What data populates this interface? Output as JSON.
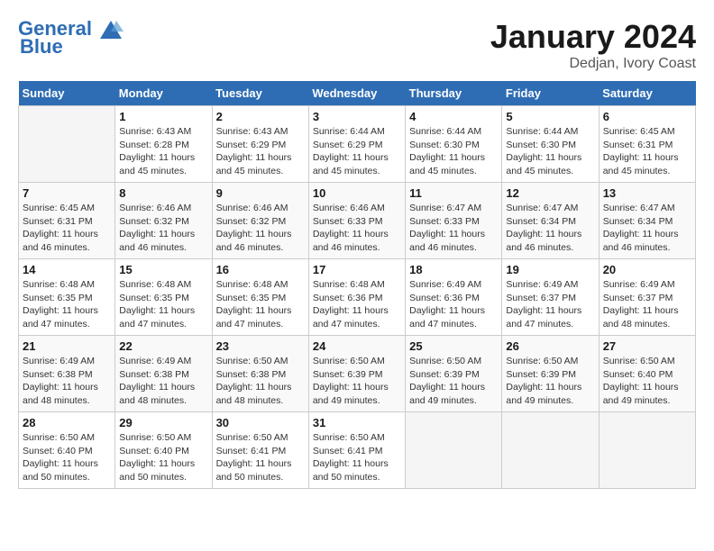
{
  "header": {
    "logo_line1": "General",
    "logo_line2": "Blue",
    "month_year": "January 2024",
    "location": "Dedjan, Ivory Coast"
  },
  "days_of_week": [
    "Sunday",
    "Monday",
    "Tuesday",
    "Wednesday",
    "Thursday",
    "Friday",
    "Saturday"
  ],
  "weeks": [
    [
      {
        "day": "",
        "info": ""
      },
      {
        "day": "1",
        "info": "Sunrise: 6:43 AM\nSunset: 6:28 PM\nDaylight: 11 hours\nand 45 minutes."
      },
      {
        "day": "2",
        "info": "Sunrise: 6:43 AM\nSunset: 6:29 PM\nDaylight: 11 hours\nand 45 minutes."
      },
      {
        "day": "3",
        "info": "Sunrise: 6:44 AM\nSunset: 6:29 PM\nDaylight: 11 hours\nand 45 minutes."
      },
      {
        "day": "4",
        "info": "Sunrise: 6:44 AM\nSunset: 6:30 PM\nDaylight: 11 hours\nand 45 minutes."
      },
      {
        "day": "5",
        "info": "Sunrise: 6:44 AM\nSunset: 6:30 PM\nDaylight: 11 hours\nand 45 minutes."
      },
      {
        "day": "6",
        "info": "Sunrise: 6:45 AM\nSunset: 6:31 PM\nDaylight: 11 hours\nand 45 minutes."
      }
    ],
    [
      {
        "day": "7",
        "info": "Sunrise: 6:45 AM\nSunset: 6:31 PM\nDaylight: 11 hours\nand 46 minutes."
      },
      {
        "day": "8",
        "info": "Sunrise: 6:46 AM\nSunset: 6:32 PM\nDaylight: 11 hours\nand 46 minutes."
      },
      {
        "day": "9",
        "info": "Sunrise: 6:46 AM\nSunset: 6:32 PM\nDaylight: 11 hours\nand 46 minutes."
      },
      {
        "day": "10",
        "info": "Sunrise: 6:46 AM\nSunset: 6:33 PM\nDaylight: 11 hours\nand 46 minutes."
      },
      {
        "day": "11",
        "info": "Sunrise: 6:47 AM\nSunset: 6:33 PM\nDaylight: 11 hours\nand 46 minutes."
      },
      {
        "day": "12",
        "info": "Sunrise: 6:47 AM\nSunset: 6:34 PM\nDaylight: 11 hours\nand 46 minutes."
      },
      {
        "day": "13",
        "info": "Sunrise: 6:47 AM\nSunset: 6:34 PM\nDaylight: 11 hours\nand 46 minutes."
      }
    ],
    [
      {
        "day": "14",
        "info": "Sunrise: 6:48 AM\nSunset: 6:35 PM\nDaylight: 11 hours\nand 47 minutes."
      },
      {
        "day": "15",
        "info": "Sunrise: 6:48 AM\nSunset: 6:35 PM\nDaylight: 11 hours\nand 47 minutes."
      },
      {
        "day": "16",
        "info": "Sunrise: 6:48 AM\nSunset: 6:35 PM\nDaylight: 11 hours\nand 47 minutes."
      },
      {
        "day": "17",
        "info": "Sunrise: 6:48 AM\nSunset: 6:36 PM\nDaylight: 11 hours\nand 47 minutes."
      },
      {
        "day": "18",
        "info": "Sunrise: 6:49 AM\nSunset: 6:36 PM\nDaylight: 11 hours\nand 47 minutes."
      },
      {
        "day": "19",
        "info": "Sunrise: 6:49 AM\nSunset: 6:37 PM\nDaylight: 11 hours\nand 47 minutes."
      },
      {
        "day": "20",
        "info": "Sunrise: 6:49 AM\nSunset: 6:37 PM\nDaylight: 11 hours\nand 48 minutes."
      }
    ],
    [
      {
        "day": "21",
        "info": "Sunrise: 6:49 AM\nSunset: 6:38 PM\nDaylight: 11 hours\nand 48 minutes."
      },
      {
        "day": "22",
        "info": "Sunrise: 6:49 AM\nSunset: 6:38 PM\nDaylight: 11 hours\nand 48 minutes."
      },
      {
        "day": "23",
        "info": "Sunrise: 6:50 AM\nSunset: 6:38 PM\nDaylight: 11 hours\nand 48 minutes."
      },
      {
        "day": "24",
        "info": "Sunrise: 6:50 AM\nSunset: 6:39 PM\nDaylight: 11 hours\nand 49 minutes."
      },
      {
        "day": "25",
        "info": "Sunrise: 6:50 AM\nSunset: 6:39 PM\nDaylight: 11 hours\nand 49 minutes."
      },
      {
        "day": "26",
        "info": "Sunrise: 6:50 AM\nSunset: 6:39 PM\nDaylight: 11 hours\nand 49 minutes."
      },
      {
        "day": "27",
        "info": "Sunrise: 6:50 AM\nSunset: 6:40 PM\nDaylight: 11 hours\nand 49 minutes."
      }
    ],
    [
      {
        "day": "28",
        "info": "Sunrise: 6:50 AM\nSunset: 6:40 PM\nDaylight: 11 hours\nand 50 minutes."
      },
      {
        "day": "29",
        "info": "Sunrise: 6:50 AM\nSunset: 6:40 PM\nDaylight: 11 hours\nand 50 minutes."
      },
      {
        "day": "30",
        "info": "Sunrise: 6:50 AM\nSunset: 6:41 PM\nDaylight: 11 hours\nand 50 minutes."
      },
      {
        "day": "31",
        "info": "Sunrise: 6:50 AM\nSunset: 6:41 PM\nDaylight: 11 hours\nand 50 minutes."
      },
      {
        "day": "",
        "info": ""
      },
      {
        "day": "",
        "info": ""
      },
      {
        "day": "",
        "info": ""
      }
    ]
  ]
}
